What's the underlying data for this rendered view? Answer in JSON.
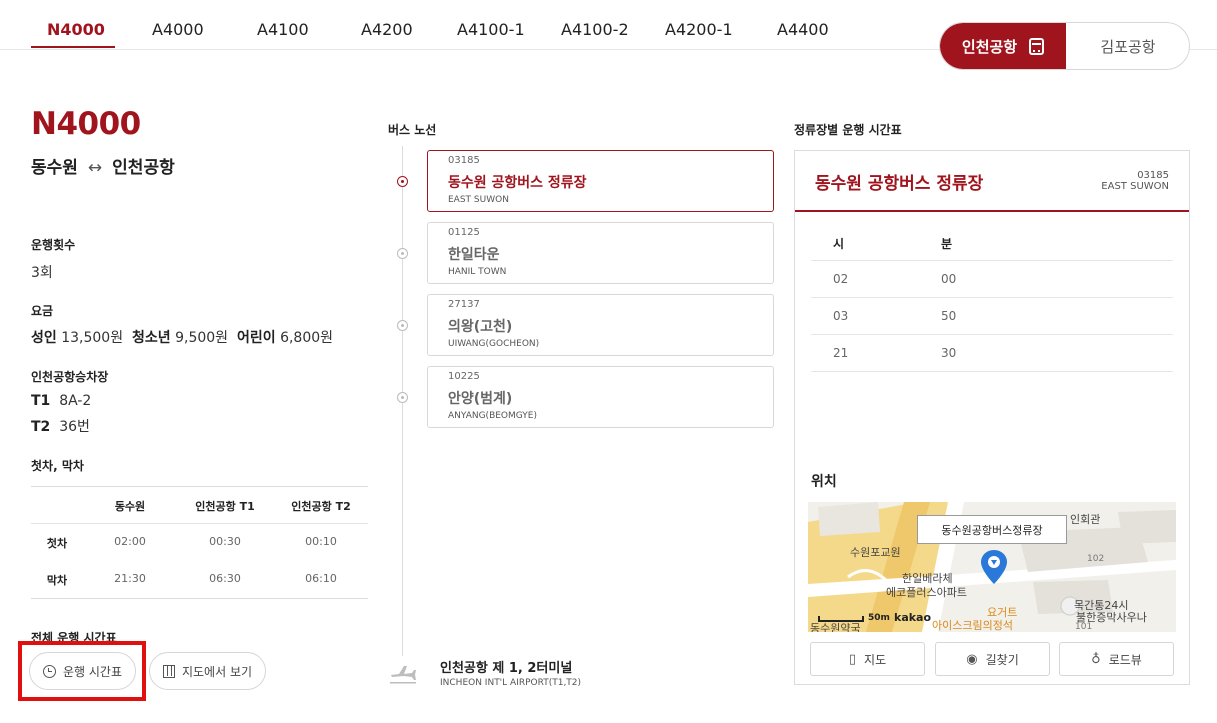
{
  "tabs": [
    {
      "label": "N4000",
      "active": true
    },
    {
      "label": "A4000"
    },
    {
      "label": "A4100"
    },
    {
      "label": "A4200"
    },
    {
      "label": "A4100-1"
    },
    {
      "label": "A4100-2"
    },
    {
      "label": "A4200-1"
    },
    {
      "label": "A4400"
    }
  ],
  "airport_toggle": {
    "active": "인천공항",
    "inactive": "김포공항",
    "active_icon": "bus-icon"
  },
  "route": {
    "number": "N4000",
    "origin": "동수원",
    "arrow": "↔",
    "destination": "인천공항"
  },
  "info": {
    "trips_label": "운행횟수",
    "trips_value": "3회",
    "fare_label": "요금",
    "fare": [
      {
        "type": "성인",
        "amount": "13,500원"
      },
      {
        "type": "청소년",
        "amount": "9,500원"
      },
      {
        "type": "어린이",
        "amount": "6,800원"
      }
    ],
    "platform_label": "인천공항승차장",
    "platforms": [
      {
        "terminal": "T1",
        "spot": "8A-2"
      },
      {
        "terminal": "T2",
        "spot": "36번"
      }
    ],
    "first_last_label": "첫차, 막차"
  },
  "first_last_table": {
    "columns": [
      "동수원",
      "인천공항 T1",
      "인천공항 T2"
    ],
    "rows": [
      {
        "label": "첫차",
        "values": [
          "02:00",
          "00:30",
          "00:10"
        ]
      },
      {
        "label": "막차",
        "values": [
          "21:30",
          "06:30",
          "06:10"
        ]
      }
    ]
  },
  "full_schedule": {
    "label": "전체 운행 시간표",
    "timetable_button": "운행 시간표",
    "map_view_button": "지도에서 보기"
  },
  "route_stops": {
    "title": "버스 노선",
    "stops": [
      {
        "code": "03185",
        "name": "동수원 공항버스 정류장",
        "en": "EAST SUWON",
        "active": true
      },
      {
        "code": "01125",
        "name": "한일타운",
        "en": "HANIL TOWN"
      },
      {
        "code": "27137",
        "name": "의왕(고천)",
        "en": "UIWANG(GOCHEON)"
      },
      {
        "code": "10225",
        "name": "안양(범계)",
        "en": "ANYANG(BEOMGYE)"
      }
    ],
    "destination": {
      "name": "인천공항 제 1, 2터미널",
      "en": "INCHEON INT'L AIRPORT(T1,T2)",
      "icon": "airplane-icon"
    }
  },
  "stop_schedule": {
    "title": "정류장별 운행 시간표",
    "stop_name": "동수원 공항버스 정류장",
    "stop_code": "03185",
    "stop_en": "EAST SUWON",
    "col_hour": "시",
    "col_minute": "분",
    "rows": [
      {
        "hour": "02",
        "minute": "00"
      },
      {
        "hour": "03",
        "minute": "50"
      },
      {
        "hour": "21",
        "minute": "30"
      }
    ],
    "location_title": "위치",
    "map": {
      "callout": "동수원공항버스정류장",
      "labels": [
        "수원포교원",
        "한일베라체",
        "에코플러스아파트",
        "요거트",
        "아이스크림의정석",
        "목간통24시",
        "불한증막사우나",
        "동수원약국",
        "인회관",
        "102",
        "101"
      ],
      "scale": "50m",
      "brand": "kakao"
    },
    "buttons": [
      {
        "label": "지도",
        "icon": "map-icon"
      },
      {
        "label": "길찾기",
        "icon": "location-pin-icon"
      },
      {
        "label": "로드뷰",
        "icon": "roadview-icon"
      }
    ]
  },
  "colors": {
    "accent": "#a0141e",
    "highlight_box": "#e01010"
  }
}
